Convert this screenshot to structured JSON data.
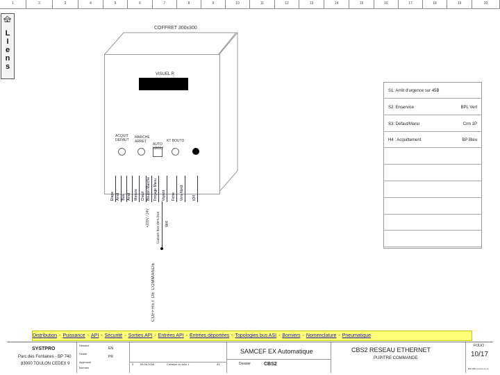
{
  "ruler": {
    "labels": [
      "1",
      "2",
      "3",
      "4",
      "5",
      "6",
      "7",
      "8",
      "9",
      "10",
      "11",
      "12",
      "13",
      "14",
      "15",
      "16",
      "17",
      "18",
      "19",
      "20"
    ]
  },
  "liens": {
    "letters": [
      "L",
      "I",
      "e",
      "n",
      "s"
    ]
  },
  "cabinet": {
    "title": "COFFRET 300x300",
    "viewer_label": "VISUEL R",
    "knobs": [
      {
        "label": "ACQUIT DEFAUT"
      },
      {
        "label": "MARCHE ARRET"
      },
      {
        "label": "AUTO MANU"
      },
      {
        "label": "KT BOUTO"
      }
    ],
    "wires": [
      "Etape",
      "Arret",
      "Bus",
      "Arret",
      "Mesure",
      "Chauf",
      "Bouton Marche",
      "Forçage Manu",
      "Voyant",
      "Fiche",
      "Vers Nord",
      "IO4"
    ],
    "cable_label": "+220V / 24V",
    "cable_label2": "Liaison bus vers bus",
    "cable_tag": "W4",
    "bottom_label": "COFFRET DE COMMANDE"
  },
  "panel": {
    "rows": [
      {
        "left": "S1: Arrêt d'urgence sur 45B",
        "right": ""
      },
      {
        "left": "S2: Enservice",
        "right": "BPL Vert"
      },
      {
        "left": "S3: Défaut/Manu",
        "right": "Crm 1P"
      },
      {
        "left": "H4 : Acquittement",
        "right": "BP Bleu"
      },
      {
        "left": "",
        "right": ""
      },
      {
        "left": "",
        "right": ""
      },
      {
        "left": "",
        "right": ""
      },
      {
        "left": "",
        "right": ""
      },
      {
        "left": "",
        "right": ""
      },
      {
        "left": "",
        "right": ""
      }
    ]
  },
  "nav": {
    "links": [
      "Distribution",
      "Puissance",
      "API",
      "Sécurité",
      "Sorties API",
      "Entrées API",
      "Entrées déportées",
      "Topologies bus ASI",
      "Borniers",
      "Nomenclature",
      "Pneumatique"
    ]
  },
  "titleblock": {
    "company": "SYSTPRO",
    "address1": "Parc des Fontaines - BP 740",
    "address2": "83000 TOULON CEDEX 9",
    "fields": [
      {
        "label": "Dessiné",
        "value": "EN"
      },
      {
        "label": "Vérifié",
        "value": "PR"
      },
      {
        "label": "Approuvé",
        "value": ""
      },
      {
        "label": "Normes",
        "value": ""
      }
    ],
    "revision": {
      "index": "0",
      "date": "05.06.2006",
      "desc": "Création du folio 1",
      "ref": "A1"
    },
    "project": "SAMCEF EX Automatique",
    "dossier_label": "Dossier",
    "dossier_value": "CBS2",
    "folio_title": "CBS2 RESEAU ETHERNET",
    "folio_subtitle": "PUPITRE COMMANDE",
    "page_label": "FOLIO",
    "page": "10/17",
    "footer_code": "ED-0001-xxxxxx-xx-xx"
  }
}
